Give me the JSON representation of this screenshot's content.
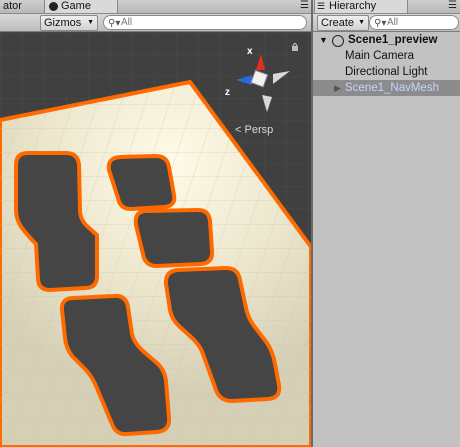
{
  "scene_panel": {
    "tab_left_partial": "ator",
    "game_tab": "Game",
    "gizmos_label": "Gizmos",
    "search_placeholder": "All",
    "persp_label": "Persp",
    "gizmo_axes": {
      "x": "x",
      "z": "z"
    }
  },
  "hierarchy": {
    "tab_label": "Hierarchy",
    "create_label": "Create",
    "search_placeholder": "All",
    "scene_name": "Scene1_preview",
    "items": [
      {
        "label": "Main Camera"
      },
      {
        "label": "Directional Light"
      },
      {
        "label": "Scene1_NavMesh"
      }
    ]
  },
  "colors": {
    "navmesh_outline": "#ff6a00",
    "selected_row": "#8c8c8c",
    "selected_text": "#c8d4ff",
    "ground": "#ece6cd",
    "x_axis": "#e0301e",
    "z_axis": "#2a6ae0"
  },
  "icons": [
    "game-controller-icon",
    "chevron-down-icon",
    "search-icon",
    "panel-menu-icon",
    "lock-icon",
    "unity-scene-icon",
    "expand-triangle-icon",
    "persp-arrow-icon"
  ]
}
